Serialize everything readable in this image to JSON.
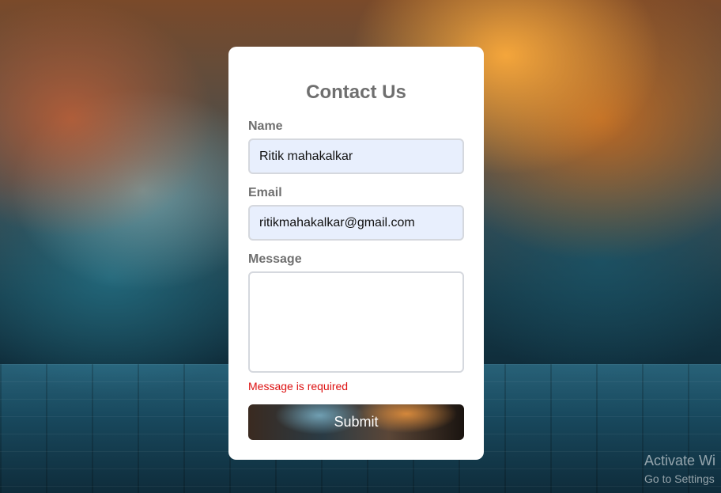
{
  "form": {
    "title": "Contact Us",
    "name_label": "Name",
    "name_value": "Ritik mahakalkar",
    "email_label": "Email",
    "email_value": "ritikmahakalkar@gmail.com",
    "message_label": "Message",
    "message_value": "",
    "error_text": "Message is required",
    "submit_label": "Submit"
  },
  "watermark": {
    "line1": "Activate Wi",
    "line2": "Go to Settings"
  },
  "colors": {
    "title": "#6f6f6f",
    "input_bg": "#e8effd",
    "error": "#dd1111"
  }
}
